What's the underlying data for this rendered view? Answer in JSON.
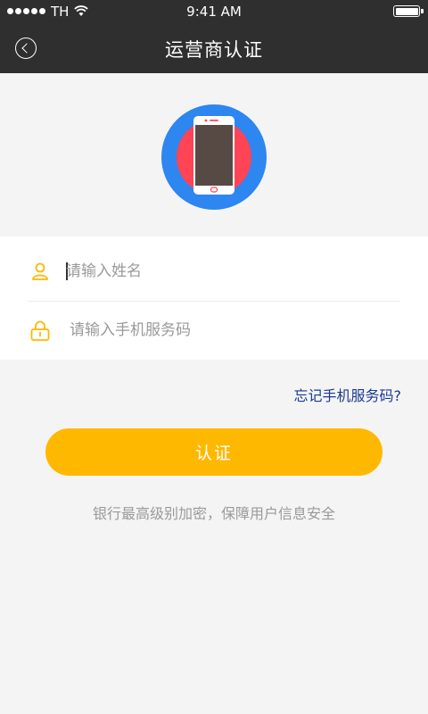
{
  "status_bar": {
    "carrier": "TH",
    "time": "9:41 AM",
    "battery_level": 1.0
  },
  "nav": {
    "title": "运营商认证",
    "back_icon": "chevron-left-circle-icon"
  },
  "hero": {
    "icon": "smartphone-icon",
    "colors": {
      "outer": "#2e86f0",
      "inner": "#ff4455",
      "screen": "#574a44"
    }
  },
  "form": {
    "name_placeholder": "请输入姓名",
    "name_value": "",
    "name_icon": "user-icon",
    "code_placeholder": "请输入手机服务码",
    "code_value": "",
    "code_icon": "lock-icon",
    "icon_color": "#ffb800"
  },
  "forgot_link": "忘记手机服务码?",
  "submit_label": "认证",
  "security_note": "银行最高级别加密，保障用户信息安全",
  "colors": {
    "header": "#2f2f2f",
    "accent": "#ffb800",
    "link": "#1b3a8e",
    "background": "#f4f4f4"
  }
}
